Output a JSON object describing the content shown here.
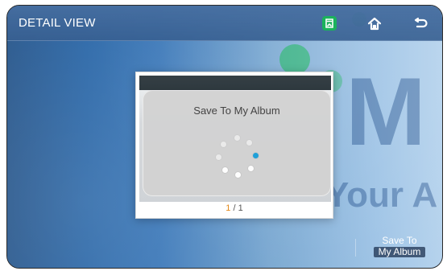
{
  "window": {
    "title": "DETAIL VIEW"
  },
  "header": {
    "buttons": [
      {
        "name": "album",
        "icon": "album-icon"
      },
      {
        "name": "home",
        "icon": "home-icon"
      },
      {
        "name": "back",
        "icon": "back-icon"
      }
    ]
  },
  "modal": {
    "save_title": "Save To My Album",
    "page": {
      "current": "1",
      "sep": "/",
      "total": "1"
    }
  },
  "bottom_action": {
    "line1": "Save To",
    "line2": "My Album"
  },
  "colors": {
    "accent_orange": "#e48a1b",
    "spinner_accent": "#1fa0d8",
    "watermark_green": "#14be50"
  }
}
